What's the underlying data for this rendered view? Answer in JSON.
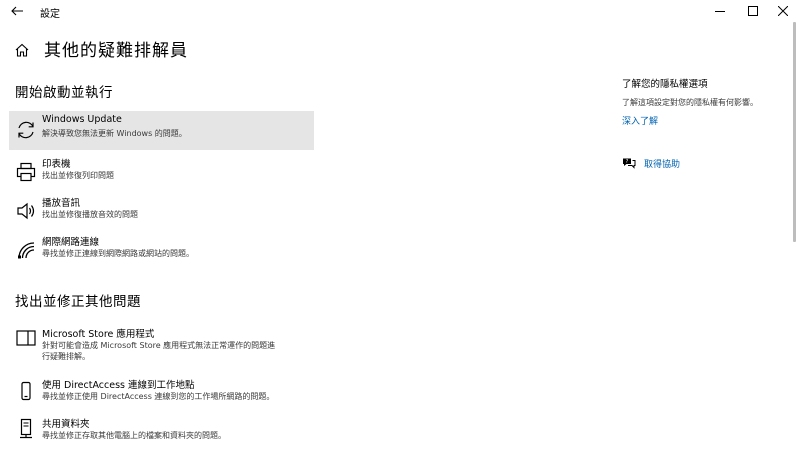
{
  "window": {
    "title": "設定"
  },
  "header": {
    "page_title": "其他的疑難排解員"
  },
  "sections": {
    "run": {
      "heading": "開始啟動並執行",
      "items": [
        {
          "name": "Windows Update",
          "desc": "解決導致您無法更新 Windows 的問題。",
          "icon": "refresh-icon",
          "selected": true
        },
        {
          "name": "印表機",
          "desc": "找出並修復列印問題",
          "icon": "printer-icon"
        },
        {
          "name": "播放音訊",
          "desc": "找出並修復播放音效的問題",
          "icon": "speaker-icon"
        },
        {
          "name": "網際網路連線",
          "desc": "尋找並修正連線到網際網路或網站的問題。",
          "icon": "wifi-signal-icon"
        }
      ]
    },
    "other": {
      "heading": "找出並修正其他問題",
      "items": [
        {
          "name": "Microsoft Store 應用程式",
          "desc": "針對可能會造成 Microsoft Store 應用程式無法正常運作的問題進",
          "desc2": "行疑難排解。",
          "icon": "app-window-icon"
        },
        {
          "name": "使用 DirectAccess 連線到工作地點",
          "desc": "尋找並修正使用 DirectAccess 連線到您的工作場所網路的問題。",
          "icon": "device-icon"
        },
        {
          "name": "共用資料夾",
          "desc": "尋找並修正存取其他電腦上的檔案和資料夾的問題。",
          "icon": "server-icon"
        }
      ]
    }
  },
  "sidebar": {
    "privacy_title": "了解您的隱私權選項",
    "privacy_desc": "了解這項設定對您的隱私權有何影響。",
    "learn_more": "深入了解",
    "get_help": "取得協助"
  },
  "colors": {
    "accent": "#0063b1",
    "selected_bg": "#e5e5e5"
  }
}
